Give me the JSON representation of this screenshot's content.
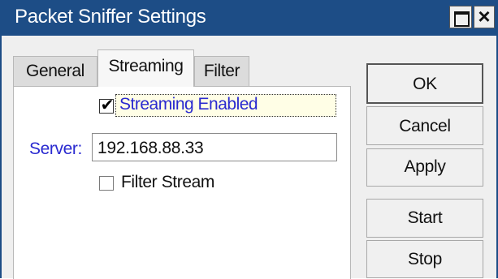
{
  "window": {
    "title": "Packet Sniffer Settings",
    "title_bar_color": "#1d4d86",
    "controls": {
      "restore_icon": "restore-icon",
      "close_glyph": "×"
    }
  },
  "tabs": [
    {
      "label": "General",
      "active": false
    },
    {
      "label": "Streaming",
      "active": true
    },
    {
      "label": "Filter",
      "active": false
    }
  ],
  "streaming": {
    "streaming_enabled": {
      "label": "Streaming Enabled",
      "checked": true,
      "check_glyph": "✔"
    },
    "server": {
      "label": "Server:",
      "value": "192.168.88.33"
    },
    "filter_stream": {
      "label": "Filter Stream",
      "checked": false
    }
  },
  "buttons": {
    "ok": "OK",
    "cancel": "Cancel",
    "apply": "Apply",
    "start": "Start",
    "stop": "Stop"
  },
  "colors": {
    "label_blue": "#2a2ad0",
    "panel_bg": "#ffffff",
    "window_bg": "#efefef"
  }
}
